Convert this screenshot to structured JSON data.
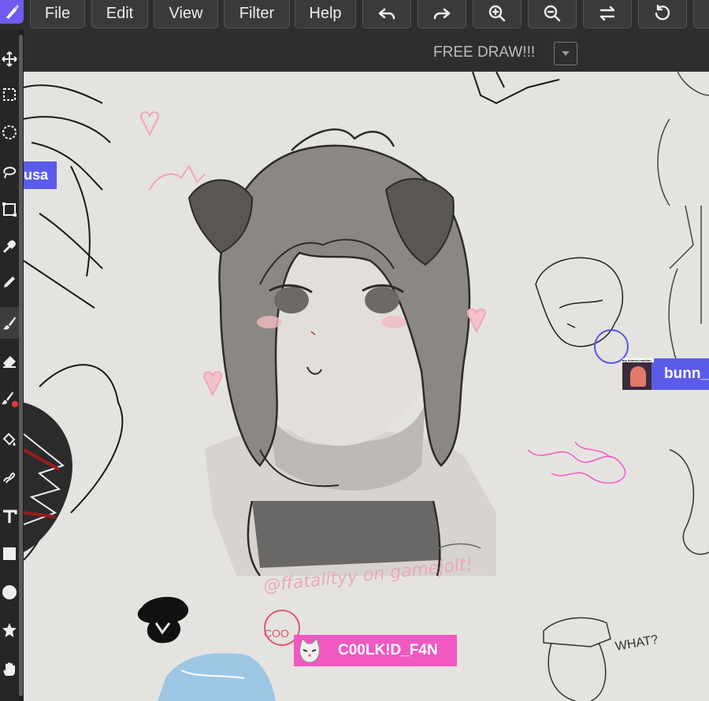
{
  "menu": {
    "file": "File",
    "edit": "Edit",
    "view": "View",
    "filter": "Filter",
    "help": "Help"
  },
  "toolbar_icons": [
    "undo-icon",
    "redo-icon",
    "zoom-in-icon",
    "zoom-out-icon",
    "swap-icon",
    "reset-icon"
  ],
  "room": {
    "name": "FREE DRAW!!!"
  },
  "tools": [
    "move",
    "rect-select",
    "lasso-select",
    "freehand-select",
    "transform",
    "eyedropper",
    "pencil",
    "brush",
    "eraser",
    "brush-color",
    "fill",
    "smudge",
    "text",
    "rectangle",
    "ellipse",
    "star",
    "hand"
  ],
  "users": {
    "left_cut": "usa",
    "bunny": "bunn_",
    "cool": "C00LK!D_F4N",
    "bunny_avatar_text": "my honest reaction"
  },
  "canvas_text": {
    "watermark": "@ffatalityy on gamejolt!",
    "what": "WHAT?",
    "coo": "COO"
  },
  "colors": {
    "accent": "#6e5bf0",
    "user_tag": "#5b5bea",
    "cool_tag": "#f158c1",
    "canvas": "#e5e3df",
    "bar": "#2e2e2e"
  }
}
